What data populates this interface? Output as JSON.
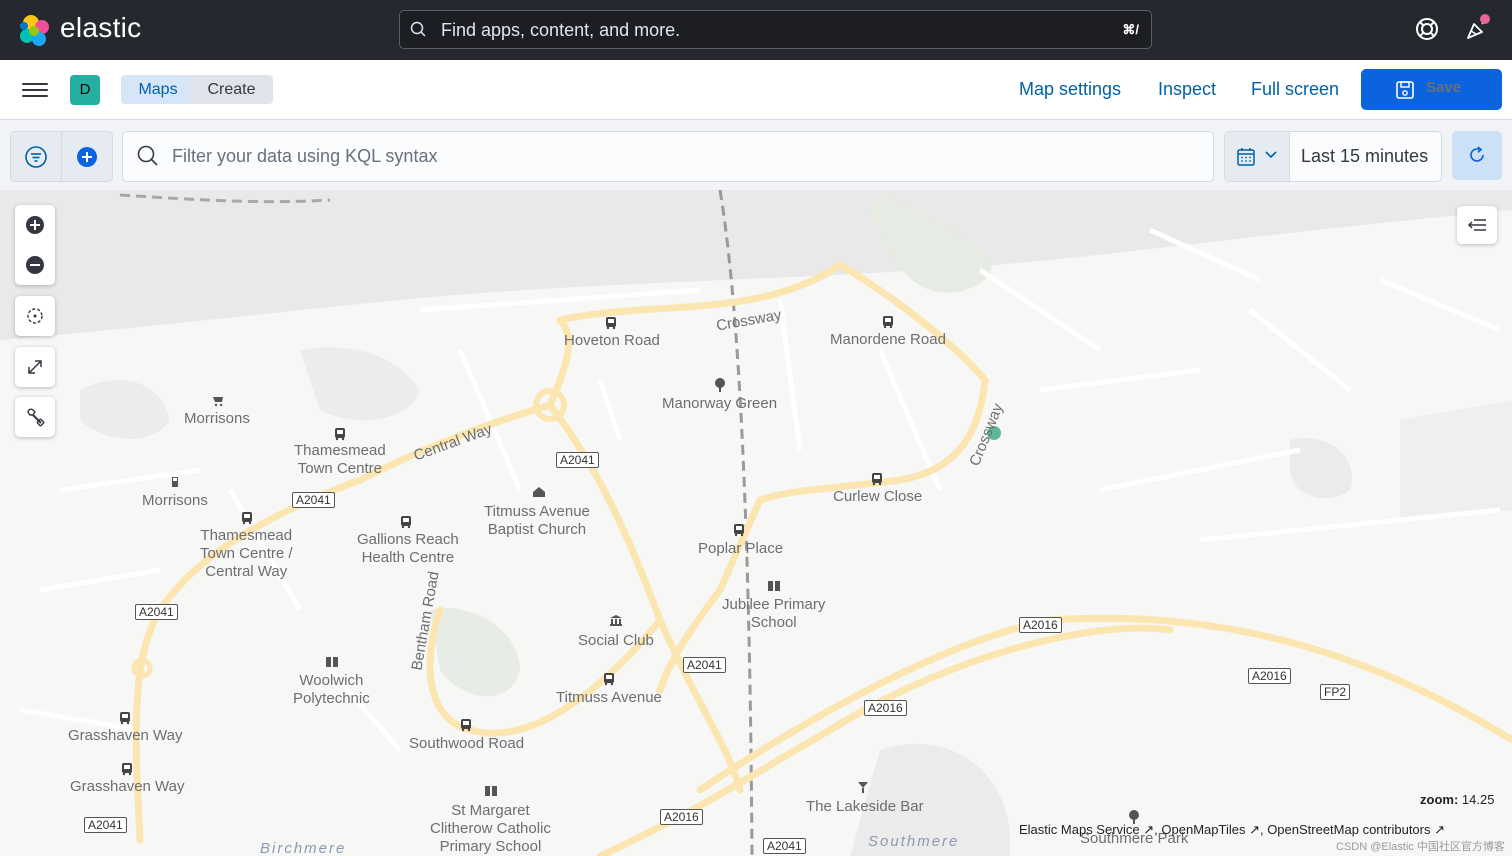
{
  "header": {
    "brand": "elastic",
    "search_placeholder": "Find apps, content, and more.",
    "search_shortcut": "⌘/"
  },
  "subbar": {
    "space_initial": "D",
    "breadcrumbs": [
      "Maps",
      "Create"
    ],
    "actions": {
      "map_settings": "Map settings",
      "inspect": "Inspect",
      "full_screen": "Full screen",
      "save": "Save"
    }
  },
  "query": {
    "placeholder": "Filter your data using KQL syntax",
    "time_range": "Last 15 minutes"
  },
  "map": {
    "zoom_label": "zoom:",
    "zoom_value": "14.25",
    "attribution": [
      "Elastic Maps Service",
      "OpenMapTiles",
      "OpenStreetMap contributors"
    ],
    "watermark": "CSDN @Elastic 中国社区官方博客",
    "place_labels": {
      "hoveton_road": "Hoveton Road",
      "crossway_top": "Crossway",
      "manordene_road": "Manordene Road",
      "manorway_green": "Manorway Green",
      "morrisons_1": "Morrisons",
      "thamesmead_town_centre_1": "Thamesmead\nTown Centre",
      "central_way": "Central Way",
      "crossway_right": "Crossway",
      "morrisons_2": "Morrisons",
      "curlew_close": "Curlew Close",
      "titmuss_baptist": "Titmuss Avenue\nBaptist Church",
      "thamesmead_town_centre_2": "Thamesmead\nTown Centre /\nCentral Way",
      "gallions_reach": "Gallions Reach\nHealth Centre",
      "poplar_place": "Poplar Place",
      "jubilee_primary": "Jubilee Primary\nSchool",
      "bentham_road": "Bentham Road",
      "social_club": "Social Club",
      "woolwich_poly": "Woolwich\nPolytechnic",
      "titmuss_avenue": "Titmuss Avenue",
      "grasshaven_way_1": "Grasshaven Way",
      "southwood_road": "Southwood Road",
      "grasshaven_way_2": "Grasshaven Way",
      "lakeside_bar": "The Lakeside Bar",
      "st_margaret": "St Margaret\nClitherow Catholic\nPrimary School",
      "birchmere": "Birchmere",
      "southmere": "Southmere",
      "southmere_park": "Southmere Park"
    },
    "road_shields": {
      "a2041_1": "A2041",
      "a2041_2": "A2041",
      "a2041_3": "A2041",
      "a2041_4": "A2041",
      "a2041_5": "A2041",
      "a2041_6": "A2041",
      "a2016_1": "A2016",
      "a2016_2": "A2016",
      "a2016_3": "A2016",
      "a2016_4": "A2016",
      "fp2": "FP2"
    }
  },
  "colors": {
    "header_bg": "#25282f",
    "primary": "#0b64dd",
    "link": "#0061a6",
    "space_avatar": "#24b0a1",
    "major_road": "#fbe6b1",
    "location_dot": "#5fb89c"
  }
}
